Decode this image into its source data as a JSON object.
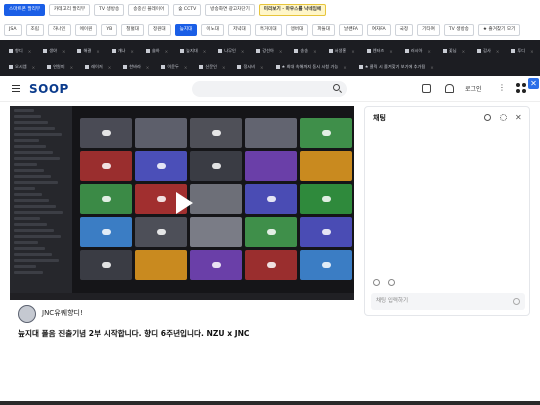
{
  "bookmarks_row1": [
    {
      "label": "스마트폰 팔리부",
      "style": "blue"
    },
    {
      "label": "카테고리 팔리부",
      "style": ""
    },
    {
      "label": "TV 생방송",
      "style": ""
    },
    {
      "label": "송중신 플레이어",
      "style": ""
    },
    {
      "label": "숲 CCTV",
      "style": ""
    },
    {
      "label": "방송화면 광고차단기",
      "style": ""
    },
    {
      "label": "미리보기 · 마우스를 낙네임에",
      "style": "yellow"
    }
  ],
  "bookmarks_row2": [
    {
      "label": "JSA",
      "style": ""
    },
    {
      "label": "조립",
      "style": ""
    },
    {
      "label": "하나인",
      "style": ""
    },
    {
      "label": "에이원",
      "style": ""
    },
    {
      "label": "YB",
      "style": ""
    },
    {
      "label": "철혈대",
      "style": ""
    },
    {
      "label": "정원대",
      "style": ""
    },
    {
      "label": "늪지대",
      "style": "blue"
    },
    {
      "label": "이노대",
      "style": ""
    },
    {
      "label": "저녁대",
      "style": ""
    },
    {
      "label": "흑거미대",
      "style": ""
    },
    {
      "label": "앵버대",
      "style": ""
    },
    {
      "label": "파들대",
      "style": ""
    },
    {
      "label": "날쌘FA",
      "style": ""
    },
    {
      "label": "여자FA",
      "style": ""
    },
    {
      "label": "국정",
      "style": ""
    },
    {
      "label": "기타여",
      "style": ""
    },
    {
      "label": "TV 생방송",
      "style": ""
    },
    {
      "label": "★ 즐겨찾기 모기",
      "style": ""
    }
  ],
  "dark_row1": [
    "향디",
    "생야",
    "해결",
    "개나",
    "슬하",
    "늪지대",
    "나무인",
    "강선아",
    "송송",
    "서생홍",
    "엔터즈",
    "러시아",
    "꽃님",
    "감사",
    "투디"
  ],
  "dark_row2": [
    "오시엠",
    "연원미",
    "레이저",
    "한바라",
    "이윤두",
    "신문인",
    "정시비",
    "★ 최대 속해까지 동시 시청 가능",
    "★ 클릭 시 즐겨찾기 보기에 추가됨"
  ],
  "header": {
    "logo": "SOOP",
    "search_placeholder": "",
    "login_label": "로그인"
  },
  "float_close": "✕",
  "video": {
    "tile_colors": [
      "#4a4b55",
      "#5d5f6b",
      "#4f5058",
      "#626470",
      "#3f8f4a",
      "#9a2e2e",
      "#4b4fb8",
      "#3a3c44",
      "#6a3fa8",
      "#c98a1f",
      "#3b8a46",
      "#a12f2f",
      "#6d6f78",
      "#4a4cb4",
      "#2f8a3c",
      "#3b7dc4",
      "#4d4f58",
      "#7a7c86",
      "#3f8f4a",
      "#4a4cb4",
      "#3a3c44",
      "#c98a1f",
      "#6a3fa8",
      "#9a2e2e",
      "#3b7dc4"
    ],
    "camera_tiles": [
      1,
      3,
      8,
      9,
      12,
      17,
      21
    ]
  },
  "streamer": {
    "name": "JNC유퀘향디!",
    "title": "늪지대 폴음 진출기념 2부 시작합니다. 향디 6주년입니다. NZU x JNC"
  },
  "chat": {
    "title": "채팅",
    "input_placeholder": "채팅 입력하기"
  }
}
